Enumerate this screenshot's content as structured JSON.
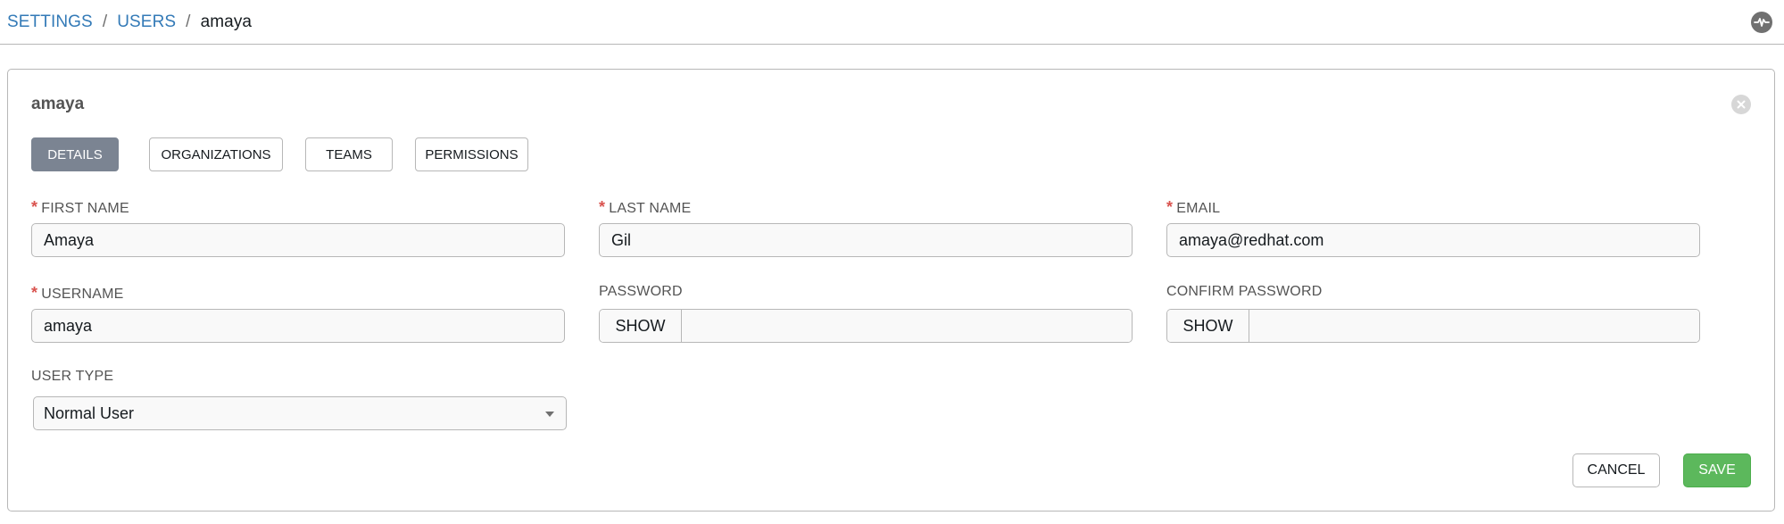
{
  "breadcrumb": {
    "settings": "SETTINGS",
    "users": "USERS",
    "separator": "/",
    "current": "amaya"
  },
  "header": {
    "activity_icon": "activity-stream-icon"
  },
  "panel": {
    "title": "amaya",
    "close_icon": "close-circle-icon",
    "tabs": [
      {
        "label": "DETAILS",
        "active": true
      },
      {
        "label": "ORGANIZATIONS",
        "active": false
      },
      {
        "label": "TEAMS",
        "active": false
      },
      {
        "label": "PERMISSIONS",
        "active": false
      }
    ]
  },
  "form": {
    "required_mark": "*",
    "first_name": {
      "label": "FIRST NAME",
      "value": "Amaya",
      "required": true
    },
    "last_name": {
      "label": "LAST NAME",
      "value": "Gil",
      "required": true
    },
    "email": {
      "label": "EMAIL",
      "value": "amaya@redhat.com",
      "required": true
    },
    "username": {
      "label": "USERNAME",
      "value": "amaya",
      "required": true
    },
    "password": {
      "label": "PASSWORD",
      "show_label": "SHOW",
      "value": ""
    },
    "confirm_password": {
      "label": "CONFIRM PASSWORD",
      "show_label": "SHOW",
      "value": ""
    },
    "user_type": {
      "label": "USER TYPE",
      "value": "Normal User"
    }
  },
  "actions": {
    "cancel": "CANCEL",
    "save": "SAVE"
  },
  "colors": {
    "link": "#337ab7",
    "active_tab": "#7b8492",
    "required": "#d9534f",
    "save": "#5cb85c"
  }
}
